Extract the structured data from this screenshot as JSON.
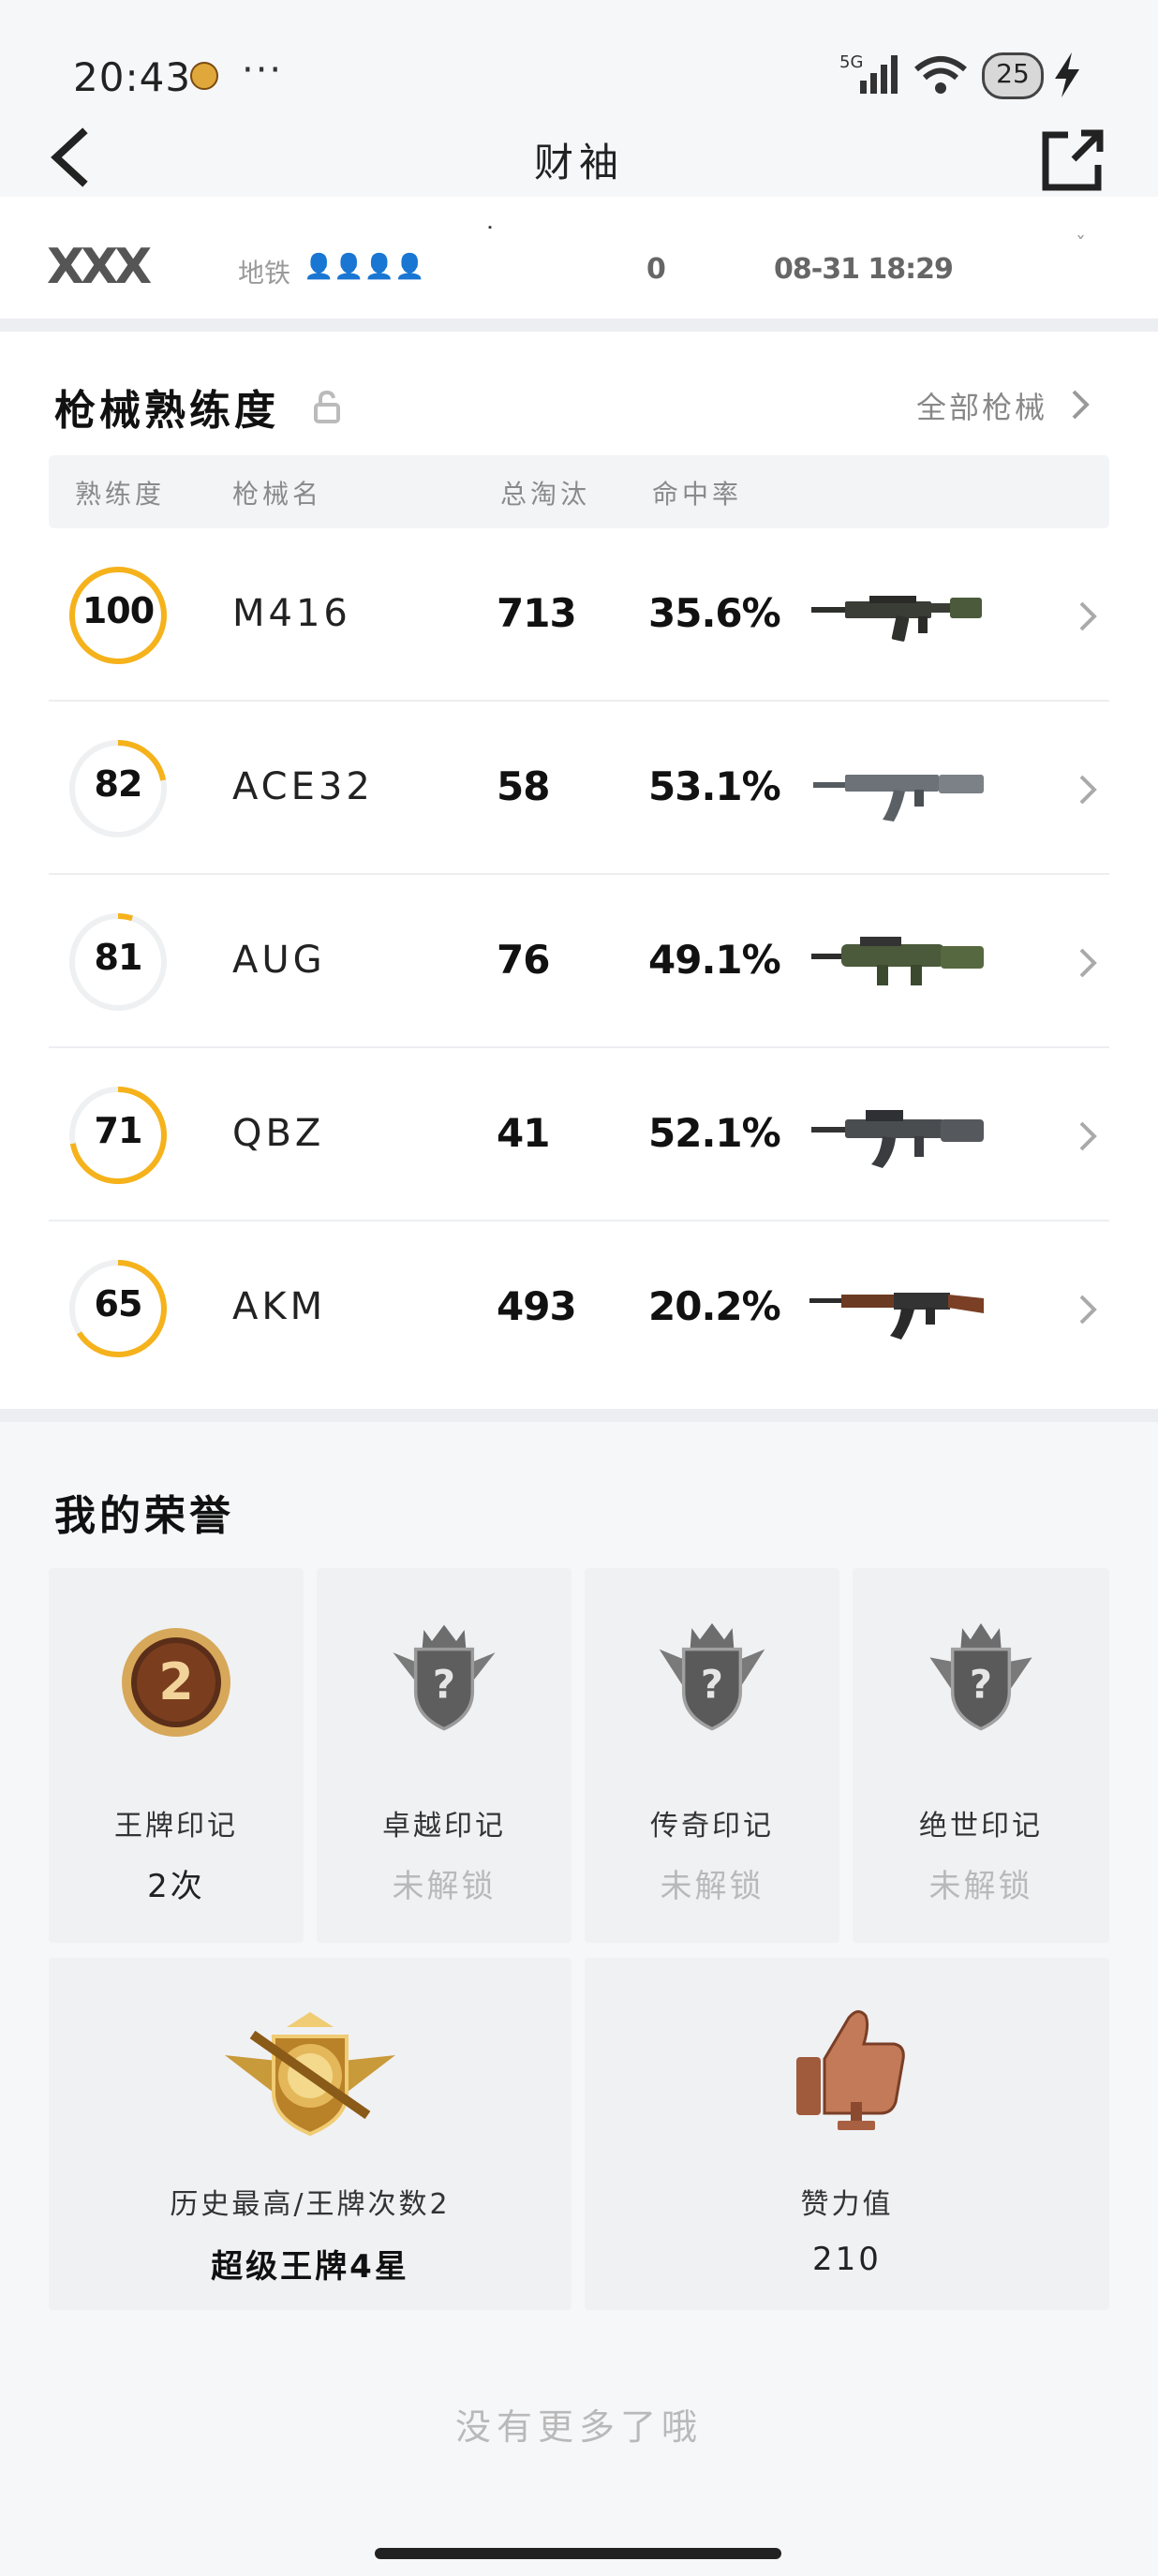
{
  "status_bar": {
    "time": "20:43",
    "dots": "···",
    "network": "5G",
    "battery": "25"
  },
  "nav": {
    "title": "财袖"
  },
  "partial_row": {
    "logo_text": "XXX",
    "subtitle": "地铁",
    "people": "👤👤👤👤",
    "mark": "˙",
    "count": "0",
    "datetime": "08-31 18:29"
  },
  "weapons": {
    "title": "枪械熟练度",
    "all_link": "全部枪械",
    "headers": {
      "proficiency": "熟练度",
      "name": "枪械名",
      "kills": "总淘汰",
      "hit_rate": "命中率"
    },
    "accent_color": "#f5b21b",
    "rows": [
      {
        "proficiency": "100",
        "progress": 1.0,
        "name": "M416",
        "kills": "713",
        "hit_rate": "35.6%",
        "gun_icon": "m416-rifle-icon"
      },
      {
        "proficiency": "82",
        "progress": 0.22,
        "name": "ACE32",
        "kills": "58",
        "hit_rate": "53.1%",
        "gun_icon": "ace32-rifle-icon"
      },
      {
        "proficiency": "81",
        "progress": 0.05,
        "name": "AUG",
        "kills": "76",
        "hit_rate": "49.1%",
        "gun_icon": "aug-rifle-icon"
      },
      {
        "proficiency": "71",
        "progress": 0.72,
        "name": "QBZ",
        "kills": "41",
        "hit_rate": "52.1%",
        "gun_icon": "qbz-rifle-icon"
      },
      {
        "proficiency": "65",
        "progress": 0.66,
        "name": "AKM",
        "kills": "493",
        "hit_rate": "20.2%",
        "gun_icon": "akm-rifle-icon"
      }
    ]
  },
  "honors": {
    "title": "我的荣誉",
    "marks": [
      {
        "label": "王牌印记",
        "value": "2次",
        "badge_number": "2",
        "locked": false
      },
      {
        "label": "卓越印记",
        "value": "未解锁",
        "badge_number": "?",
        "locked": true
      },
      {
        "label": "传奇印记",
        "value": "未解锁",
        "badge_number": "?",
        "locked": true
      },
      {
        "label": "绝世印记",
        "value": "未解锁",
        "badge_number": "?",
        "locked": true
      }
    ],
    "highest": {
      "label": "历史最高/王牌次数2",
      "value": "超级王牌4星"
    },
    "likes": {
      "label": "赞力值",
      "value": "210"
    }
  },
  "footer": {
    "note": "没有更多了哦"
  }
}
